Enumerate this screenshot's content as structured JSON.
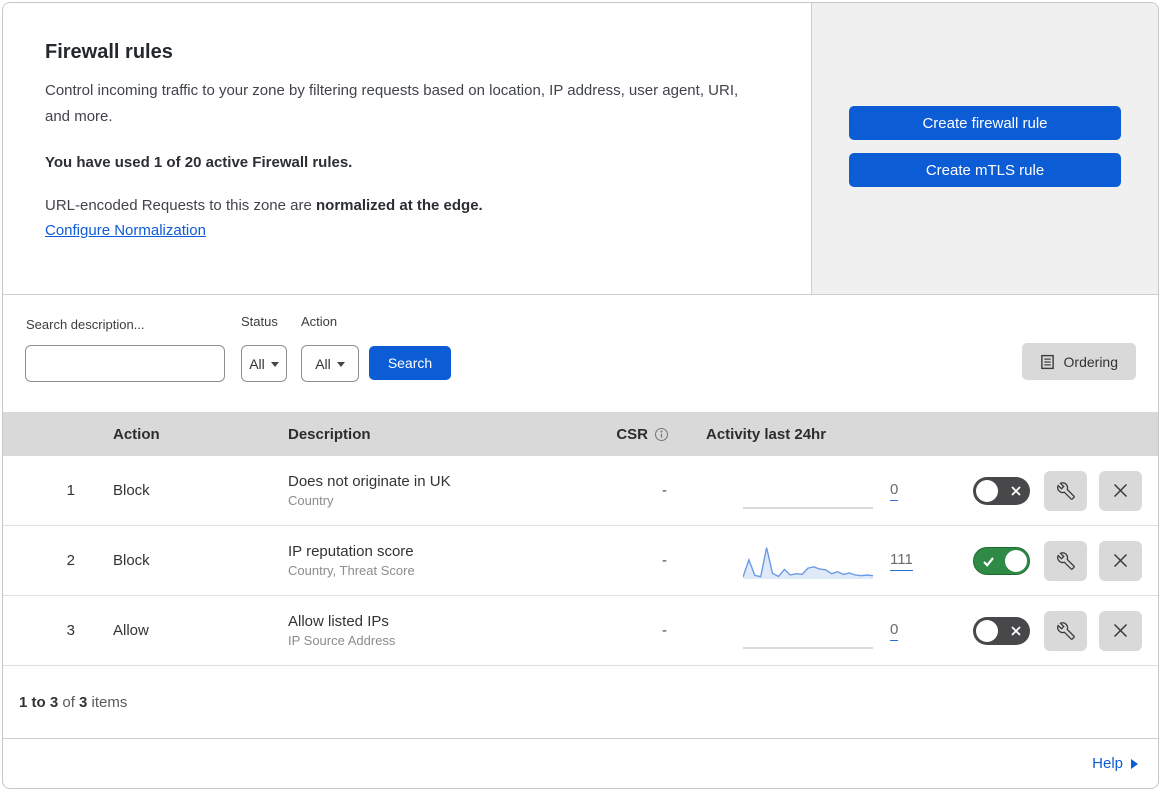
{
  "hero": {
    "title": "Firewall rules",
    "description": "Control incoming traffic to your zone by filtering requests based on location, IP address, user agent, URI, and more.",
    "usage": "You have used 1 of 20 active Firewall rules.",
    "normalization_prefix": "URL-encoded Requests to this zone are ",
    "normalization_bold": "normalized at the edge.",
    "normalization_link": "Configure Normalization",
    "create_firewall_button": "Create firewall rule",
    "create_mtls_button": "Create mTLS rule"
  },
  "filters": {
    "search_label": "Search description...",
    "search_value": "",
    "status_label": "Status",
    "status_value": "All",
    "action_label": "Action",
    "action_value": "All",
    "search_button": "Search",
    "ordering_button": "Ordering"
  },
  "table": {
    "columns": {
      "action": "Action",
      "description": "Description",
      "csr": "CSR",
      "activity": "Activity last 24hr"
    },
    "rows": [
      {
        "priority": "1",
        "action": "Block",
        "description": "Does not originate in UK",
        "fields": "Country",
        "csr": "-",
        "activity_count": "0",
        "enabled": false,
        "sparkline": null
      },
      {
        "priority": "2",
        "action": "Block",
        "description": "IP reputation score",
        "fields": "Country, Threat Score",
        "csr": "-",
        "activity_count": "111",
        "enabled": true,
        "sparkline": [
          3,
          55,
          8,
          4,
          92,
          14,
          5,
          26,
          9,
          13,
          11,
          30,
          34,
          27,
          25,
          13,
          19,
          11,
          15,
          9,
          7,
          9,
          7
        ]
      },
      {
        "priority": "3",
        "action": "Allow",
        "description": "Allow listed IPs",
        "fields": "IP Source Address",
        "csr": "-",
        "activity_count": "0",
        "enabled": false,
        "sparkline": null
      }
    ]
  },
  "footer": {
    "range_bold": "1 to 3",
    "of_text": " of ",
    "total_bold": "3",
    "items_text": " items",
    "help_link": "Help"
  },
  "colors": {
    "accent_blue": "#0b5cd5",
    "link_blue": "#0f5bd8",
    "toggle_on_green": "#2e8a45",
    "toggle_off_gray": "#48484b",
    "sparkline_stroke": "#6b9be6",
    "sparkline_fill": "#dfe9f8",
    "zero_line_gray": "#c3c3c3",
    "table_header_bg": "#d9d9d9",
    "panel_gray": "#f0f0f1"
  }
}
